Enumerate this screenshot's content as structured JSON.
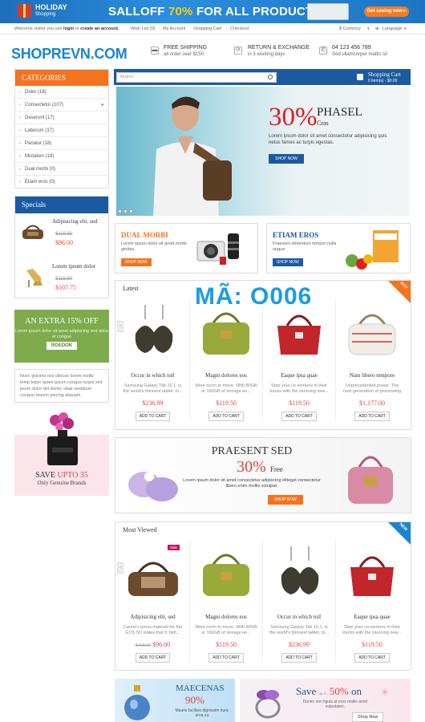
{
  "banner": {
    "holiday": "HOLIDAY",
    "shopping": "Shopping",
    "sale_prefix": "SALLOFF",
    "sale_pct": "70%",
    "sale_suffix": "FOR ALL PRODUCTS",
    "cta": "Get saving now ▸"
  },
  "toplinks": {
    "welcome": "Welcome visitor you can",
    "login": "login",
    "or": "or",
    "create": "create an account.",
    "wishlist": "Wish List (0)",
    "account": "My Account",
    "cart": "Shopping Cart",
    "checkout": "Checkout",
    "currency": "$  Currency",
    "language": "Language"
  },
  "header": {
    "logo": "SHOPREVN.COM",
    "ship_t": "FREE SHIPPING",
    "ship_s": "all order over $150",
    "ret_t": "RETURN & EXCHANGE",
    "ret_s": "in 3 working days",
    "phone_t": "04 123 456 789",
    "phone_s": "Sed ullamcorper mattis sit"
  },
  "categories": {
    "title": "CATEGORIES",
    "items": [
      "Dolor (18)",
      "Consectetur (107)",
      "Deserunt (17)",
      "Laborum (17)",
      "Pariatur (18)",
      "Mistaken (18)",
      "Dual morbi (0)",
      "Etiam eros (0)"
    ]
  },
  "specials": {
    "title": "Specials",
    "items": [
      {
        "name": "Adipisicing elit, sed",
        "old": "$119.50",
        "new": "$96.00"
      },
      {
        "name": "Lorem ipsum dolor",
        "old": "$119.50",
        "new": "$107.75"
      }
    ]
  },
  "extra": {
    "title": "AN EXTRA 15% OFF",
    "text": "Lorem ipsum dolor sit amet adipiscing sed dolor et congue",
    "btn": "ROEDOK"
  },
  "note": "Nunc gravida nisi ultrices lorem mollis temp tepor quam ipsum congue turpis sed psum dolor dol donec vitae vestibum congue mauris piscing aliquam.",
  "save": {
    "prefix": "SAVE",
    "upto": "UPTO 35",
    "sub": "Only Genuine Brands"
  },
  "search": {
    "placeholder": "Search"
  },
  "cart": {
    "title": "Shopping Cart",
    "summary": "0 item(s) - $0.00"
  },
  "slider": {
    "pct": "30%",
    "title": "PHASEL",
    "sub": "Cras",
    "text": "Lorem ipsum dolor sit amet consectetur adipisicing quis netus fames ac turpis egestas.",
    "btn": "SHOP NOW"
  },
  "promo1": {
    "title": "DUAL MORBI",
    "text": "Lorem ipsum dolor sit amet morbi gestas.",
    "btn": "SHOP NOW"
  },
  "promo2": {
    "title": "ETIAM EROS",
    "text": "Praesent dimentum tempor nulla augue.",
    "btn": "SHOP NOW"
  },
  "latest": {
    "title": "Latest",
    "badge": "HOT",
    "products": [
      {
        "name": "Occur in which toil",
        "desc": "Samsung Galaxy Tab 10.1, is the world's thinnest tablet, m...",
        "price": "$236.99",
        "btn": "ADD TO CART"
      },
      {
        "name": "Magni dolores eos",
        "desc": "More room to move. With 80GB or 160GB of storage an...",
        "price": "$119.50",
        "btn": "ADD TO CART"
      },
      {
        "name": "Eaque ipsa quae",
        "desc": "Stop your co-workers in their tracks with the stunning new...",
        "price": "$119.50",
        "btn": "ADD TO CART"
      },
      {
        "name": "Nam libero tempore",
        "desc": "Unprecedented power. The next generation of processing",
        "price": "$1,177.00",
        "btn": "ADD TO CART"
      }
    ]
  },
  "watermark": "MÃ: O006",
  "praesent": {
    "title": "PRAESENT SED",
    "pct": "30%",
    "free": "Free",
    "text": "Lorem ipsum dolor sit amet consectetur adipiscing eliteget consectetur libero enim mollis volutpat.",
    "btn": "SHOP NOW"
  },
  "mostviewed": {
    "title": "Most Viewed",
    "badge": "NEW",
    "sale": "Sale",
    "products": [
      {
        "name": "Adipisicing elit, sed",
        "desc": "Canon's press material for the EOS 5D states that it 'defi...",
        "old": "$119.50",
        "price": "$96.00",
        "btn": "ADD TO CART"
      },
      {
        "name": "Magni dolores eos",
        "desc": "More room to move. With 80GB or 160GB of storage an...",
        "price": "$119.50",
        "btn": "ADD TO CART"
      },
      {
        "name": "Occur in which toil",
        "desc": "Samsung Galaxy Tab 10.1, is the world's thinnest tablet, m...",
        "price": "$236.99",
        "btn": "ADD TO CART"
      },
      {
        "name": "Eaque ipsa quae",
        "desc": "Stop your co-workers in their tracks with the stunning new...",
        "price": "$119.50",
        "btn": "ADD TO CART"
      }
    ]
  },
  "bottom1": {
    "title": "MAECENAS",
    "pct": "90%",
    "text": "Mauris facilisis dignissim nunc urna eu"
  },
  "bottom2": {
    "save": "Save",
    "upto": "up to",
    "pct": "50%",
    "on": "on",
    "text": "Donec non ligula at eros mollis amet vulputates.",
    "btn": "Shop Now"
  },
  "colors": {
    "orange": "#f3731f",
    "navy": "#1c5aa0",
    "red": "#e0453a",
    "green": "#7eab4c",
    "blue": "#1a86d0"
  }
}
